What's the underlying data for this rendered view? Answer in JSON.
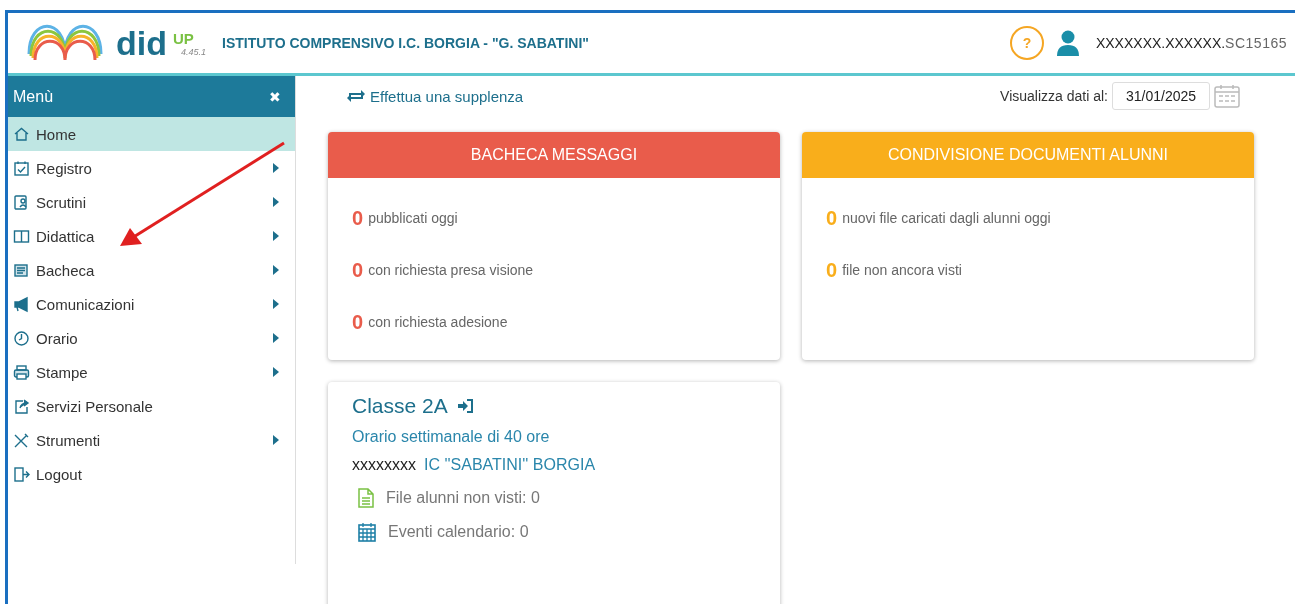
{
  "header": {
    "logo_text": "did",
    "logo_sup": "UP",
    "version": "4.45.1",
    "school": "ISTITUTO COMPRENSIVO I.C. BORGIA - \"G. SABATINI\"",
    "help": "?",
    "user": "XXXXXXX.XXXXXX.",
    "user_code": "SC15165"
  },
  "sidebar": {
    "title": "Menù",
    "close": "✖",
    "items": [
      {
        "label": "Home",
        "selected": true,
        "has_submenu": false
      },
      {
        "label": "Registro",
        "selected": false,
        "has_submenu": true
      },
      {
        "label": "Scrutini",
        "selected": false,
        "has_submenu": true
      },
      {
        "label": "Didattica",
        "selected": false,
        "has_submenu": true
      },
      {
        "label": "Bacheca",
        "selected": false,
        "has_submenu": true
      },
      {
        "label": "Comunicazioni",
        "selected": false,
        "has_submenu": true
      },
      {
        "label": "Orario",
        "selected": false,
        "has_submenu": true
      },
      {
        "label": "Stampe",
        "selected": false,
        "has_submenu": true
      },
      {
        "label": "Servizi Personale",
        "selected": false,
        "has_submenu": false
      },
      {
        "label": "Strumenti",
        "selected": false,
        "has_submenu": true
      },
      {
        "label": "Logout",
        "selected": false,
        "has_submenu": false
      }
    ]
  },
  "toolbar": {
    "substitution_link": "Effettua una supplenza",
    "date_label": "Visualizza dati al:",
    "date_value": "31/01/2025"
  },
  "cards": [
    {
      "title": "BACHECA MESSAGGI",
      "color": "#e95c4b",
      "stats": [
        {
          "count": "0",
          "label": "pubblicati oggi"
        },
        {
          "count": "0",
          "label": "con richiesta presa visione"
        },
        {
          "count": "0",
          "label": "con richiesta adesione"
        }
      ]
    },
    {
      "title": "CONDIVISIONE DOCUMENTI ALUNNI",
      "color": "#f9ae1b",
      "stats": [
        {
          "count": "0",
          "label": "nuovi file caricati dagli alunni oggi"
        },
        {
          "count": "0",
          "label": "file non ancora visti"
        }
      ]
    }
  ],
  "class_card": {
    "title": "Classe 2A",
    "schedule": "Orario settimanale di 40 ore",
    "teacher": "xxxxxxxx",
    "school": "IC ''SABATINI'' BORGIA",
    "details": [
      {
        "label": "File alunni non visti: 0"
      },
      {
        "label": "Eventi calendario: 0"
      }
    ]
  }
}
